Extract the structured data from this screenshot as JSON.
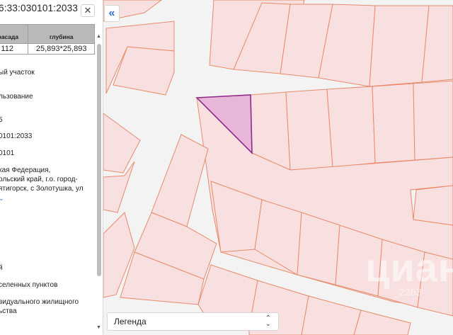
{
  "panel": {
    "cadastral_number": "6:33:030101:2033",
    "close_icon": "close-icon",
    "table": {
      "headers": [
        "фасада",
        "глубина"
      ],
      "row": [
        "112",
        "25,893*25,893"
      ]
    },
    "info_lines": [
      "ый участок",
      "льзование",
      "5",
      "0101:2033",
      "0101",
      "кая Федерация,",
      "ольский край, г.о. город-",
      "ятигорск, с Золотушка, ул",
      "",
      "й",
      "селенных пунктов",
      "видуального жилищного",
      "ьства"
    ],
    "expand_chevron_icon": "chevron-down-icon"
  },
  "map": {
    "collapse_label": "«",
    "legend_label": "Легенда",
    "legend_icon": "up-down-arrows-icon",
    "watermark": "циан",
    "watermark_id": "2263",
    "colors": {
      "parcel_fill": "#f9e0e0",
      "parcel_stroke": "#e88a6a",
      "selected_fill": "#e8b6d8",
      "selected_stroke": "#8e2a8a",
      "road": "#f4f3f3"
    }
  }
}
